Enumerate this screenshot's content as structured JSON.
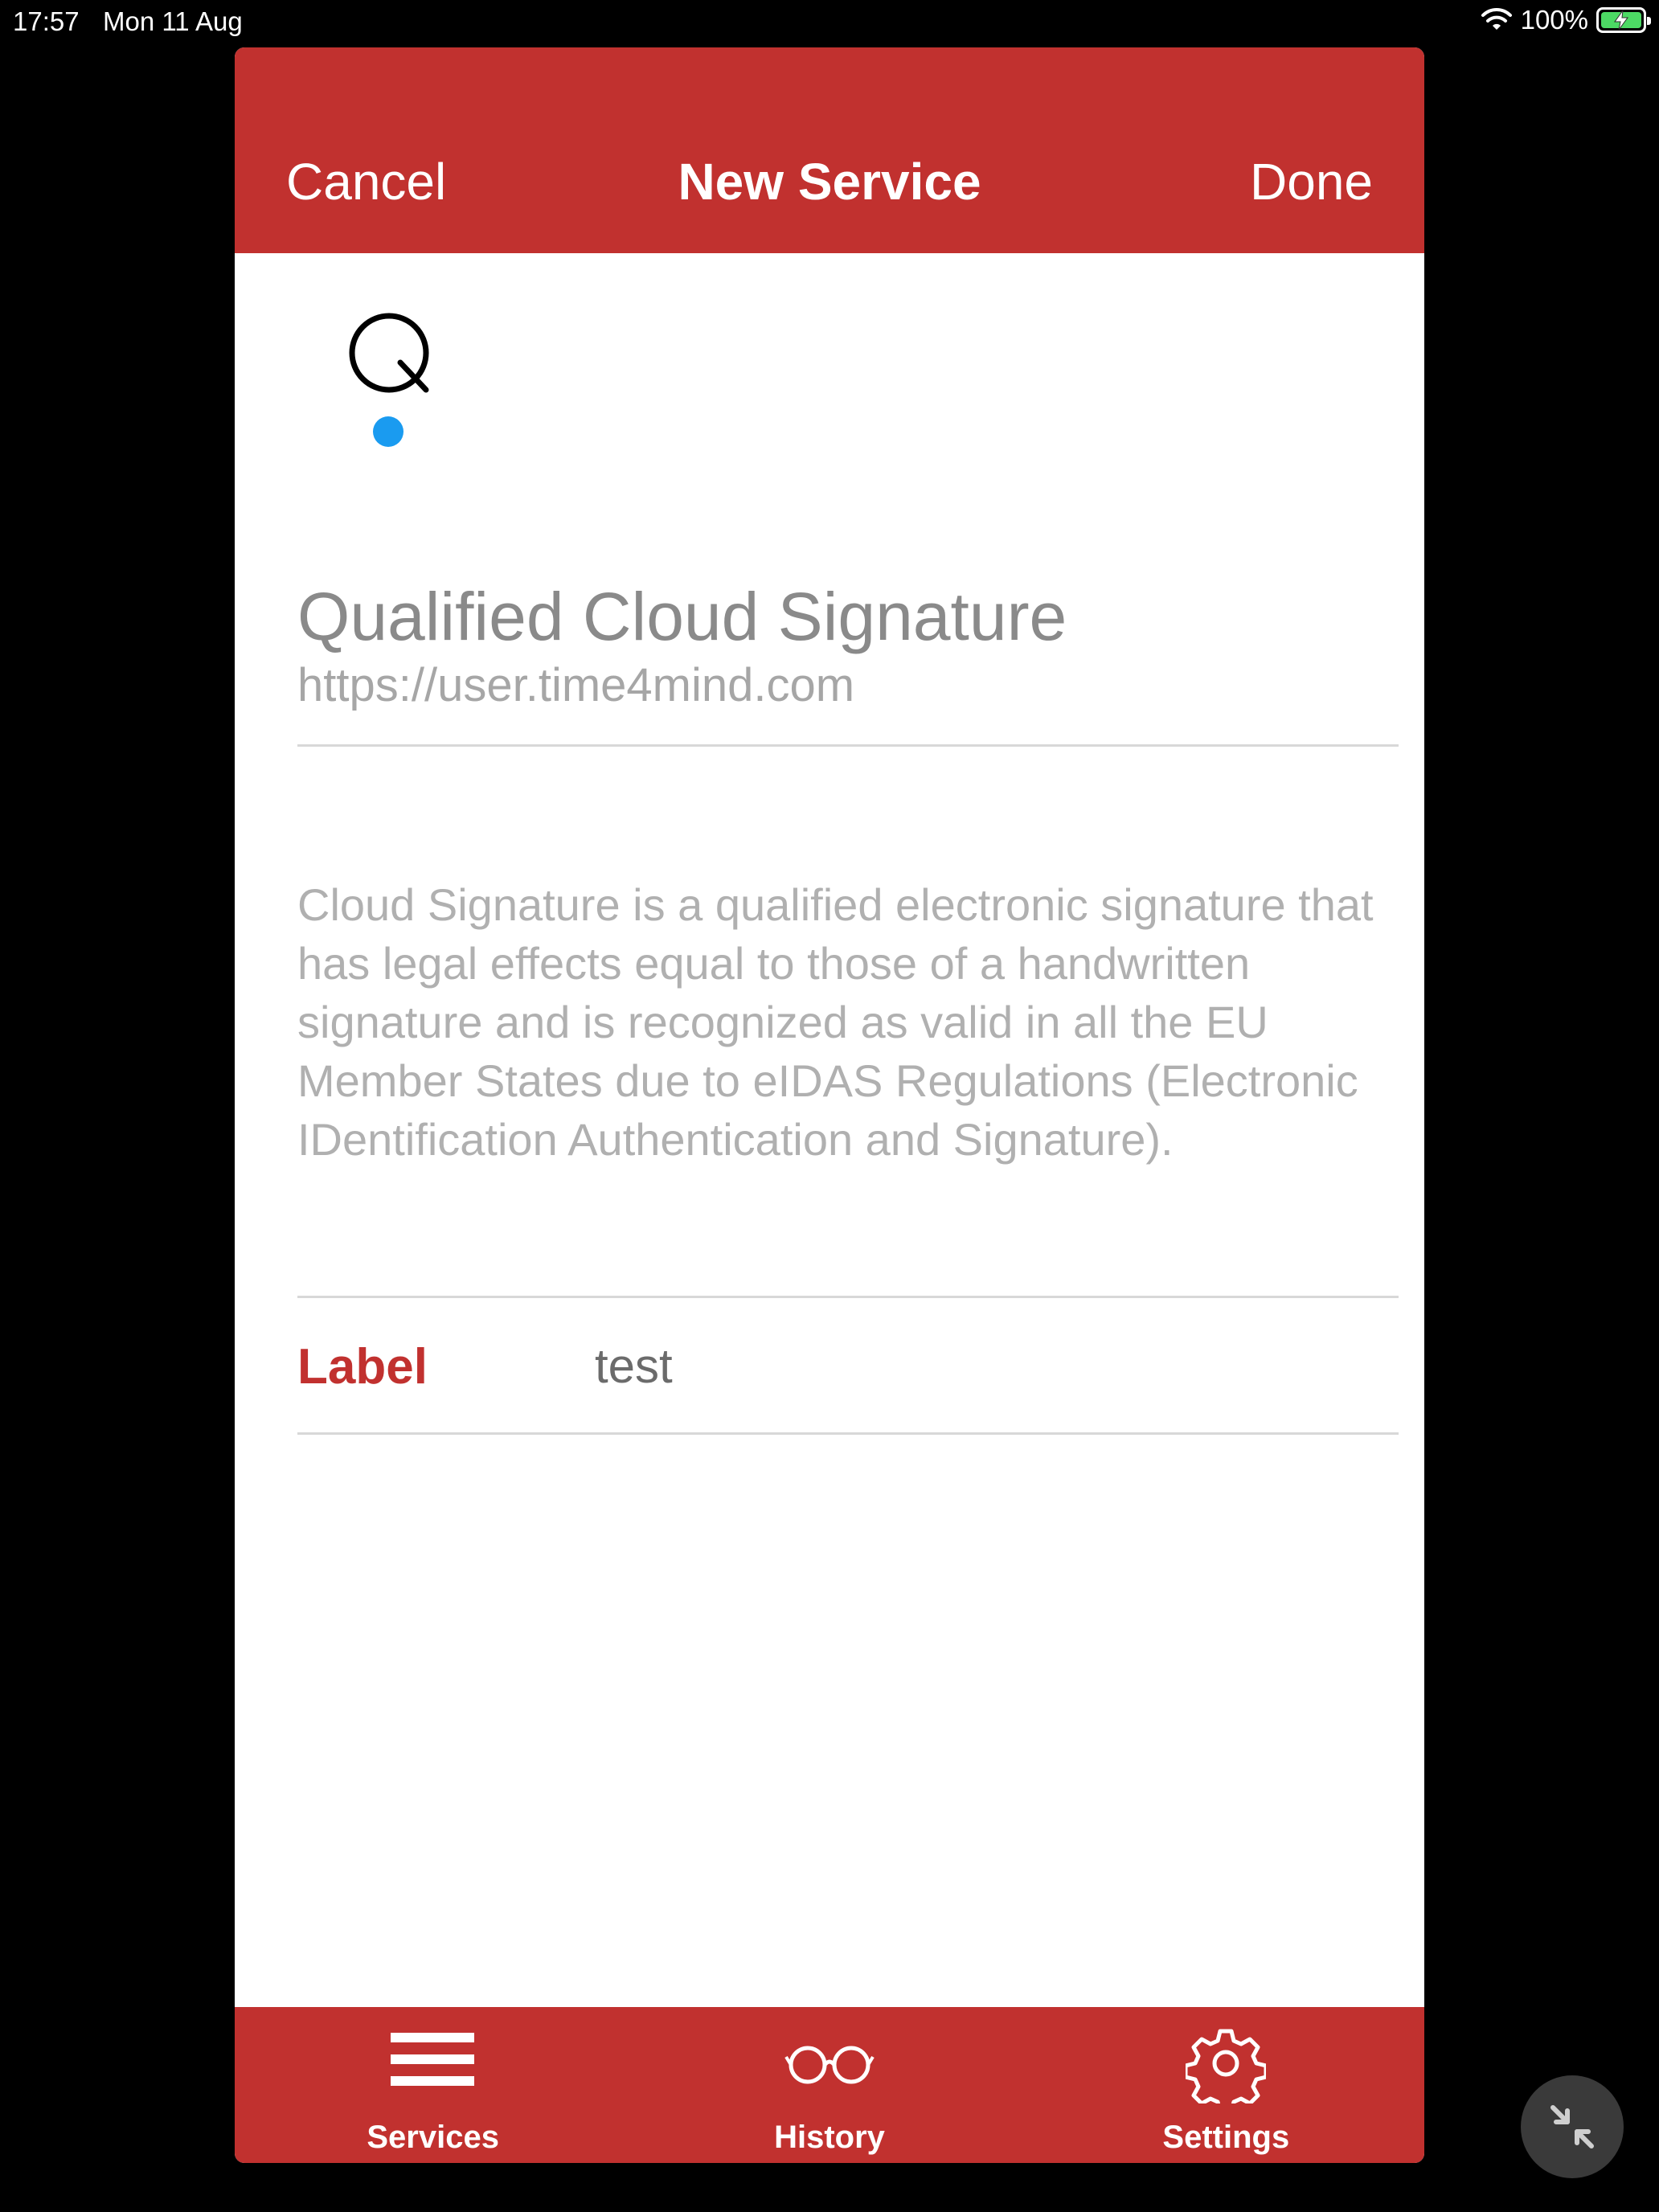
{
  "status_bar": {
    "time": "17:57",
    "date": "Mon 11 Aug",
    "battery": "100%",
    "battery_level": 1.0,
    "battery_color": "#4cd964",
    "icons": [
      "wifi-icon",
      "battery-icon",
      "charging-bolt-icon"
    ]
  },
  "nav": {
    "cancel_label": "Cancel",
    "title": "New Service",
    "done_label": "Done",
    "background_color": "#c1312f"
  },
  "service": {
    "logo_icon": "qualified-q-logo",
    "logo_dot_color": "#1a9bf0",
    "name": "Qualified Cloud Signature",
    "url": "https://user.time4mind.com",
    "description": "Cloud Signature is a qualified electronic signature that has legal effects equal to those of a handwritten signature and is recognized as valid in all the EU Member States due to eIDAS Regulations (Electronic IDentification Authentication and Signature)."
  },
  "label_field": {
    "key": "Label",
    "value": "test",
    "key_color": "#c1312f"
  },
  "tab_bar": {
    "items": [
      {
        "label": "Services",
        "icon": "hamburger-icon"
      },
      {
        "label": "History",
        "icon": "glasses-icon"
      },
      {
        "label": "Settings",
        "icon": "gear-icon"
      }
    ]
  },
  "overlay": {
    "minimize_icon": "minimize-arrows-icon"
  }
}
